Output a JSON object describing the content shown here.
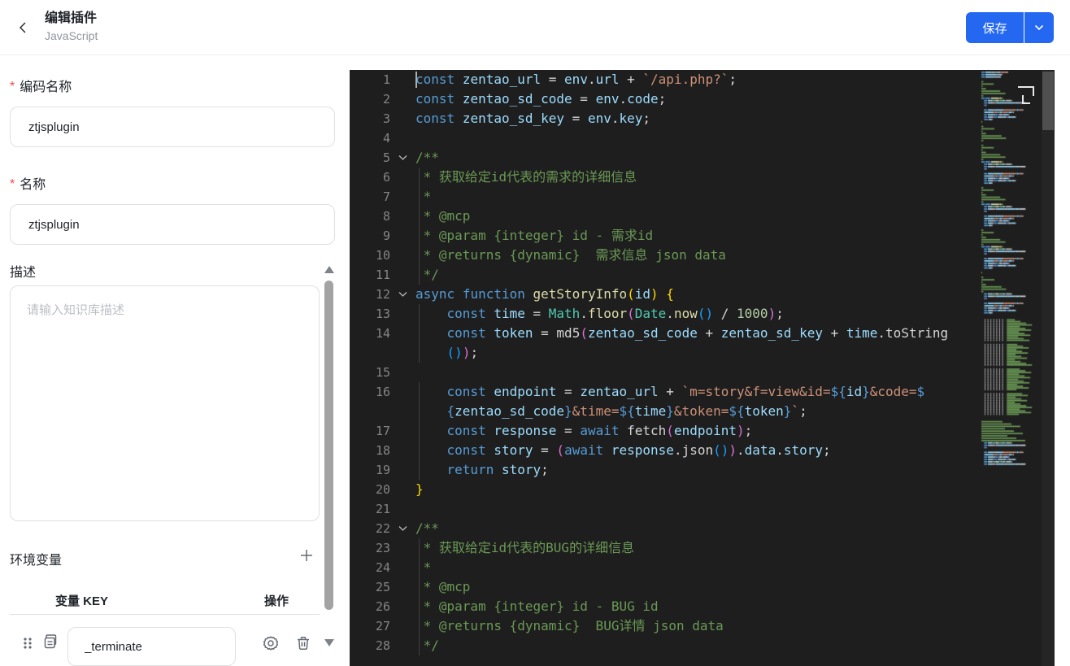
{
  "header": {
    "title": "编辑插件",
    "subtitle": "JavaScript",
    "save_label": "保存"
  },
  "form": {
    "required_mark": "*",
    "code_name": {
      "label": "编码名称",
      "value": "ztjsplugin"
    },
    "name": {
      "label": "名称",
      "value": "ztjsplugin"
    },
    "description": {
      "label": "描述",
      "placeholder": "请输入知识库描述",
      "value": ""
    },
    "env_vars": {
      "title": "环境变量",
      "columns": [
        "变量 KEY",
        "操作"
      ],
      "rows": [
        {
          "key": "_terminate"
        }
      ]
    }
  },
  "editor": {
    "colors": {
      "bg": "#1e1e1e",
      "line_number": "#858585",
      "kw": "#569cd6",
      "var": "#9cdcfe",
      "str": "#ce9178",
      "com": "#6a9955",
      "num": "#b5cea8",
      "fn": "#dcdcaa",
      "cls": "#4ec9b0",
      "txt": "#d4d4d4",
      "b1": "#ffd700",
      "b2": "#da70d6",
      "b3": "#179fff"
    },
    "rows": [
      {
        "n": "1",
        "c": true,
        "t": [
          [
            "const",
            "kw"
          ],
          [
            " ",
            "txt"
          ],
          [
            "zentao_url",
            "var"
          ],
          [
            " = ",
            "txt"
          ],
          [
            "env",
            "var"
          ],
          [
            ".",
            "txt"
          ],
          [
            "url",
            "var"
          ],
          [
            " + ",
            "txt"
          ],
          [
            "`/api.php?`",
            "str"
          ],
          [
            ";",
            "txt"
          ]
        ]
      },
      {
        "n": "2",
        "t": [
          [
            "const",
            "kw"
          ],
          [
            " ",
            "txt"
          ],
          [
            "zentao_sd_code",
            "var"
          ],
          [
            " = ",
            "txt"
          ],
          [
            "env",
            "var"
          ],
          [
            ".",
            "txt"
          ],
          [
            "code",
            "var"
          ],
          [
            ";",
            "txt"
          ]
        ]
      },
      {
        "n": "3",
        "t": [
          [
            "const",
            "kw"
          ],
          [
            " ",
            "txt"
          ],
          [
            "zentao_sd_key",
            "var"
          ],
          [
            " = ",
            "txt"
          ],
          [
            "env",
            "var"
          ],
          [
            ".",
            "txt"
          ],
          [
            "key",
            "var"
          ],
          [
            ";",
            "txt"
          ]
        ]
      },
      {
        "n": "4",
        "t": []
      },
      {
        "n": "5",
        "f": true,
        "t": [
          [
            "/**",
            "com"
          ]
        ]
      },
      {
        "n": "6",
        "g": true,
        "t": [
          [
            " * 获取给定id代表的需求的详细信息",
            "com"
          ]
        ]
      },
      {
        "n": "7",
        "g": true,
        "t": [
          [
            " *",
            "com"
          ]
        ]
      },
      {
        "n": "8",
        "g": true,
        "t": [
          [
            " * @mcp",
            "com"
          ]
        ]
      },
      {
        "n": "9",
        "g": true,
        "t": [
          [
            " * @param {integer} id - 需求id",
            "com"
          ]
        ]
      },
      {
        "n": "10",
        "g": true,
        "t": [
          [
            " * @returns {dynamic}  需求信息 json data",
            "com"
          ]
        ]
      },
      {
        "n": "11",
        "g": true,
        "t": [
          [
            " */",
            "com"
          ]
        ]
      },
      {
        "n": "12",
        "f": true,
        "t": [
          [
            "async",
            "kw"
          ],
          [
            " ",
            "txt"
          ],
          [
            "function",
            "kw"
          ],
          [
            " ",
            "txt"
          ],
          [
            "getStoryInfo",
            "fn"
          ],
          [
            "(",
            "b1"
          ],
          [
            "id",
            "var"
          ],
          [
            ")",
            "b1"
          ],
          [
            " ",
            "txt"
          ],
          [
            "{",
            "b1"
          ]
        ]
      },
      {
        "n": "13",
        "g": true,
        "t": [
          [
            "    ",
            "txt"
          ],
          [
            "const",
            "kw"
          ],
          [
            " ",
            "txt"
          ],
          [
            "time",
            "var"
          ],
          [
            " = ",
            "txt"
          ],
          [
            "Math",
            "cls"
          ],
          [
            ".",
            "txt"
          ],
          [
            "floor",
            "fn"
          ],
          [
            "(",
            "b2"
          ],
          [
            "Date",
            "cls"
          ],
          [
            ".",
            "txt"
          ],
          [
            "now",
            "fn"
          ],
          [
            "(",
            "b3"
          ],
          [
            ")",
            "b3"
          ],
          [
            " / ",
            "txt"
          ],
          [
            "1000",
            "num"
          ],
          [
            ")",
            "b2"
          ],
          [
            ";",
            "txt"
          ]
        ]
      },
      {
        "n": "14",
        "g": true,
        "t": [
          [
            "    ",
            "txt"
          ],
          [
            "const",
            "kw"
          ],
          [
            " ",
            "txt"
          ],
          [
            "token",
            "var"
          ],
          [
            " = ",
            "txt"
          ],
          [
            "md5",
            "txt"
          ],
          [
            "(",
            "b2"
          ],
          [
            "zentao_sd_code",
            "var"
          ],
          [
            " + ",
            "txt"
          ],
          [
            "zentao_sd_key",
            "var"
          ],
          [
            " + ",
            "txt"
          ],
          [
            "time",
            "var"
          ],
          [
            ".",
            "txt"
          ],
          [
            "toString",
            "txt"
          ]
        ]
      },
      {
        "n": "",
        "g": true,
        "t": [
          [
            "    ",
            "txt"
          ],
          [
            "(",
            "b3"
          ],
          [
            ")",
            "b3"
          ],
          [
            ")",
            "b2"
          ],
          [
            ";",
            "txt"
          ]
        ]
      },
      {
        "n": "15",
        "g": true,
        "t": []
      },
      {
        "n": "16",
        "g": true,
        "t": [
          [
            "    ",
            "txt"
          ],
          [
            "const",
            "kw"
          ],
          [
            " ",
            "txt"
          ],
          [
            "endpoint",
            "var"
          ],
          [
            " = ",
            "txt"
          ],
          [
            "zentao_url",
            "var"
          ],
          [
            " + ",
            "txt"
          ],
          [
            "`m=story&f=view&id=",
            "str"
          ],
          [
            "${",
            "kw"
          ],
          [
            "id",
            "var"
          ],
          [
            "}",
            "kw"
          ],
          [
            "&code=",
            "str"
          ],
          [
            "$",
            "kw"
          ]
        ]
      },
      {
        "n": "",
        "g": true,
        "t": [
          [
            "    ",
            "txt"
          ],
          [
            "{",
            "kw"
          ],
          [
            "zentao_sd_code",
            "var"
          ],
          [
            "}",
            "kw"
          ],
          [
            "&time=",
            "str"
          ],
          [
            "${",
            "kw"
          ],
          [
            "time",
            "var"
          ],
          [
            "}",
            "kw"
          ],
          [
            "&token=",
            "str"
          ],
          [
            "${",
            "kw"
          ],
          [
            "token",
            "var"
          ],
          [
            "}",
            "kw"
          ],
          [
            "`",
            "str"
          ],
          [
            ";",
            "txt"
          ]
        ]
      },
      {
        "n": "17",
        "g": true,
        "t": [
          [
            "    ",
            "txt"
          ],
          [
            "const",
            "kw"
          ],
          [
            " ",
            "txt"
          ],
          [
            "response",
            "var"
          ],
          [
            " = ",
            "txt"
          ],
          [
            "await",
            "kw"
          ],
          [
            " ",
            "txt"
          ],
          [
            "fetch",
            "txt"
          ],
          [
            "(",
            "b2"
          ],
          [
            "endpoint",
            "var"
          ],
          [
            ")",
            "b2"
          ],
          [
            ";",
            "txt"
          ]
        ]
      },
      {
        "n": "18",
        "g": true,
        "t": [
          [
            "    ",
            "txt"
          ],
          [
            "const",
            "kw"
          ],
          [
            " ",
            "txt"
          ],
          [
            "story",
            "var"
          ],
          [
            " = ",
            "txt"
          ],
          [
            "(",
            "b2"
          ],
          [
            "await",
            "kw"
          ],
          [
            " ",
            "txt"
          ],
          [
            "response",
            "var"
          ],
          [
            ".",
            "txt"
          ],
          [
            "json",
            "txt"
          ],
          [
            "(",
            "b3"
          ],
          [
            ")",
            "b3"
          ],
          [
            ")",
            "b2"
          ],
          [
            ".",
            "txt"
          ],
          [
            "data",
            "var"
          ],
          [
            ".",
            "txt"
          ],
          [
            "story",
            "var"
          ],
          [
            ";",
            "txt"
          ]
        ]
      },
      {
        "n": "19",
        "g": true,
        "t": [
          [
            "    ",
            "txt"
          ],
          [
            "return",
            "kw"
          ],
          [
            " ",
            "txt"
          ],
          [
            "story",
            "var"
          ],
          [
            ";",
            "txt"
          ]
        ]
      },
      {
        "n": "20",
        "t": [
          [
            "}",
            "b1"
          ]
        ]
      },
      {
        "n": "21",
        "t": []
      },
      {
        "n": "22",
        "f": true,
        "t": [
          [
            "/**",
            "com"
          ]
        ]
      },
      {
        "n": "23",
        "g": true,
        "t": [
          [
            " * 获取给定id代表的BUG的详细信息",
            "com"
          ]
        ]
      },
      {
        "n": "24",
        "g": true,
        "t": [
          [
            " *",
            "com"
          ]
        ]
      },
      {
        "n": "25",
        "g": true,
        "t": [
          [
            " * @mcp",
            "com"
          ]
        ]
      },
      {
        "n": "26",
        "g": true,
        "t": [
          [
            " * @param {integer} id - BUG id",
            "com"
          ]
        ]
      },
      {
        "n": "27",
        "g": true,
        "t": [
          [
            " * @returns {dynamic}  BUG详情 json data",
            "com"
          ]
        ]
      },
      {
        "n": "28",
        "g": true,
        "t": [
          [
            " */",
            "com"
          ]
        ]
      }
    ]
  }
}
